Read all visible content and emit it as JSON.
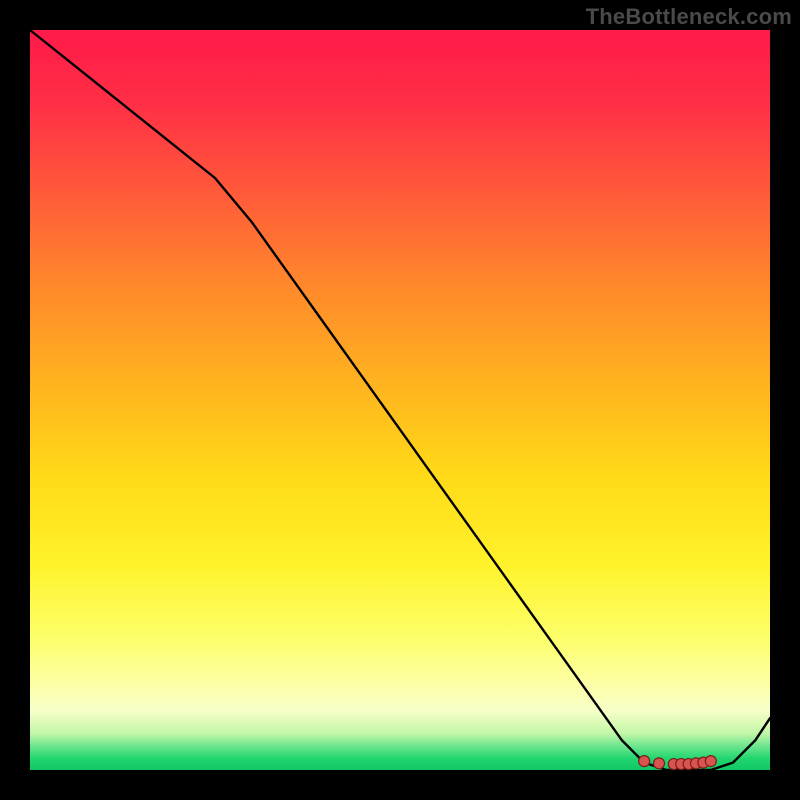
{
  "watermark": "TheBottleneck.com",
  "chart_data": {
    "type": "line",
    "title": "",
    "xlabel": "",
    "ylabel": "",
    "xlim": [
      0,
      100
    ],
    "ylim": [
      0,
      100
    ],
    "x": [
      0,
      5,
      10,
      15,
      20,
      25,
      30,
      35,
      40,
      45,
      50,
      55,
      60,
      65,
      70,
      75,
      80,
      83,
      86,
      89,
      92,
      95,
      98,
      100
    ],
    "values": [
      100,
      96,
      92,
      88,
      84,
      80,
      74,
      67,
      60,
      53,
      46,
      39,
      32,
      25,
      18,
      11,
      4,
      1,
      0,
      0,
      0,
      1,
      4,
      7
    ],
    "markers_x": [
      83,
      85,
      87,
      88,
      89,
      90,
      91,
      92
    ],
    "markers_y": [
      1.2,
      0.9,
      0.8,
      0.8,
      0.8,
      0.9,
      1.0,
      1.2
    ],
    "colors": {
      "line": "#000000",
      "marker_fill": "#d9534f",
      "marker_stroke": "#7a1f1c",
      "gradient_top": "#ff1a4a",
      "gradient_bottom": "#11c765"
    }
  }
}
